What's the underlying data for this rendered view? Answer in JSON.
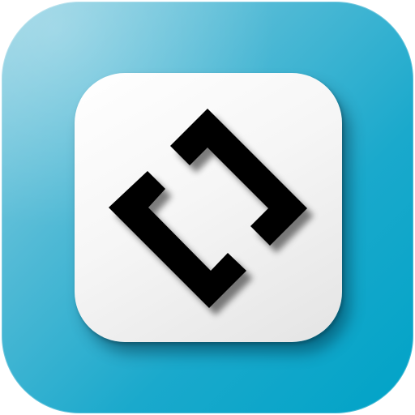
{
  "app_icon": {
    "icon": "code-brackets-icon",
    "colors": {
      "background_gradient_start": "#8fd0e2",
      "background_gradient_end": "#00a3c7",
      "tile": "#f4f4f4",
      "glyph": "#000000"
    }
  }
}
